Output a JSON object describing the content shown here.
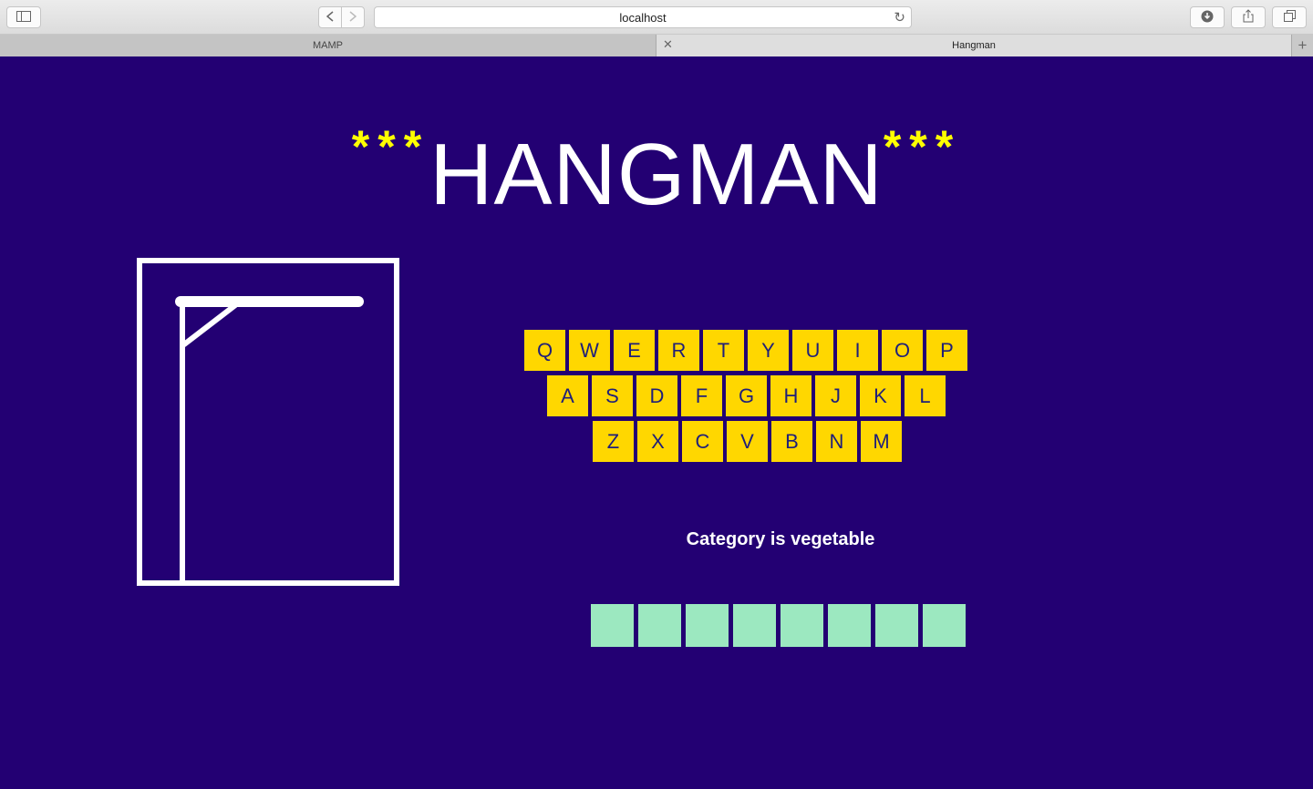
{
  "browser": {
    "url": "localhost",
    "tabs": [
      {
        "label": "MAMP"
      },
      {
        "label": "Hangman"
      }
    ]
  },
  "game": {
    "title": "HANGMAN",
    "stars_left": "***",
    "stars_right": "***",
    "category": "Category is vegetable",
    "keyboard": {
      "row1": [
        "Q",
        "W",
        "E",
        "R",
        "T",
        "Y",
        "U",
        "I",
        "O",
        "P"
      ],
      "row2": [
        "A",
        "S",
        "D",
        "F",
        "G",
        "H",
        "J",
        "K",
        "L"
      ],
      "row3": [
        "Z",
        "X",
        "C",
        "V",
        "B",
        "N",
        "M"
      ]
    },
    "word_length": 8,
    "wrong_guesses": 0
  },
  "colors": {
    "background": "#230073",
    "key": "#ffd700",
    "key_text": "#1f1f7a",
    "slot": "#9ce8c0",
    "stars": "#ffff00"
  }
}
